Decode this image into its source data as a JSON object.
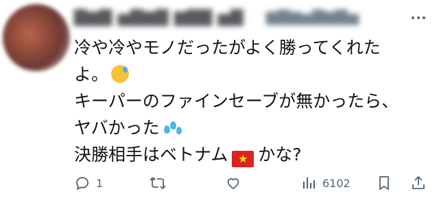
{
  "tweet": {
    "lines": [
      "冷や冷やモノだったがよく勝ってくれた",
      "よ。",
      "キーパーのファインセーブが無かったら、",
      "ヤバかった",
      "決勝相手はベトナム",
      "かな?"
    ]
  },
  "actions": {
    "reply_count": "1",
    "views_count": "6102"
  },
  "icons": [
    "avatar",
    "more-icon",
    "sweat-smile-emoji",
    "sweat-droplets-emoji",
    "vietnam-flag-emoji",
    "reply-icon",
    "retweet-icon",
    "like-icon",
    "views-icon",
    "bookmark-icon",
    "share-icon"
  ],
  "colors": {
    "text": "#0f1419",
    "muted": "#536471",
    "background": "#ffffff"
  }
}
